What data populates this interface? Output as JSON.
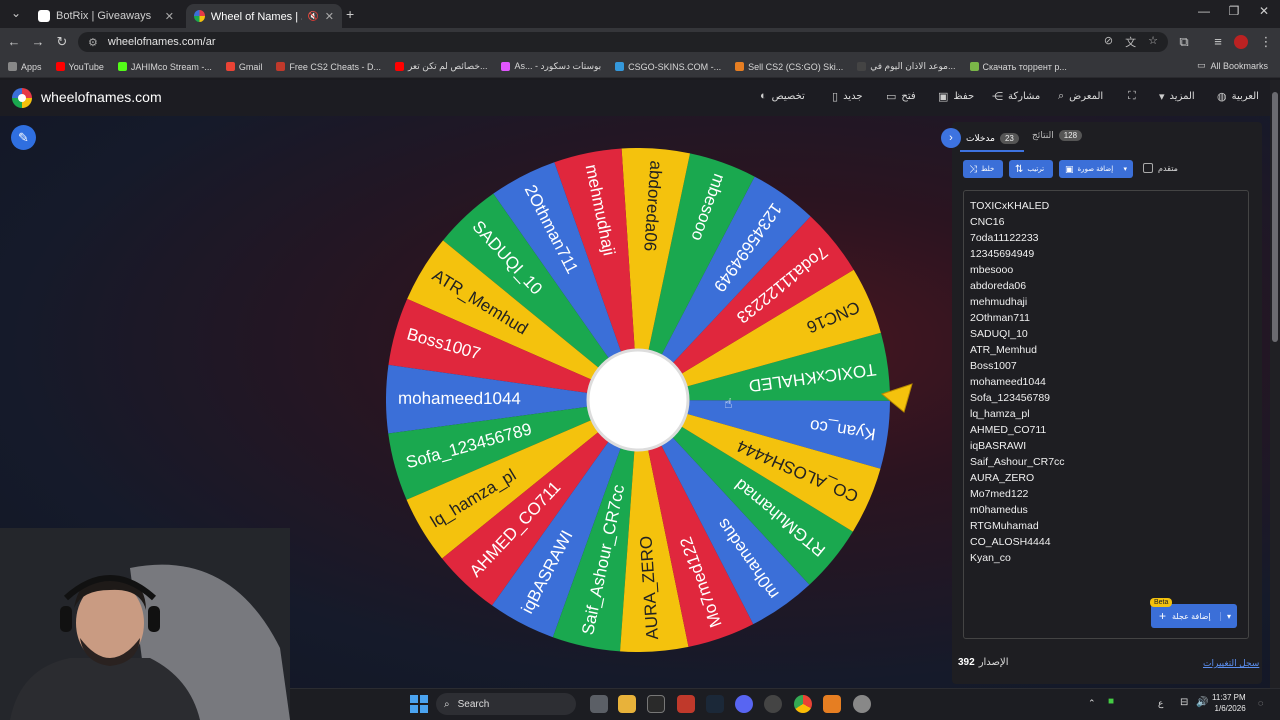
{
  "browser": {
    "tabs": [
      {
        "title": "BotRix | Giveaways",
        "favicon_color": "#ffffff"
      },
      {
        "title": "Wheel of Names | العشوائي",
        "favicon_color": "#e63946"
      }
    ],
    "url": "wheelofnames.com/ar",
    "bookmarks": [
      {
        "label": "Apps",
        "color": "#888888"
      },
      {
        "label": "YouTube",
        "color": "#ff0000"
      },
      {
        "label": "JAHIMco Stream -...",
        "color": "#53fc18"
      },
      {
        "label": "Gmail",
        "color": "#ea4335"
      },
      {
        "label": "Free CS2 Cheats - D...",
        "color": "#c0392b"
      },
      {
        "label": "خصائص لم تكن تعر...",
        "color": "#ff0000"
      },
      {
        "label": "As... - بوستات دسكورد",
        "color": "#e056fd"
      },
      {
        "label": "CSGO-SKINS.COM -...",
        "color": "#3498db"
      },
      {
        "label": "Sell CS2 (CS:GO) Ski...",
        "color": "#e67e22"
      },
      {
        "label": "موعد الاذان اليوم في...",
        "color": "#444444"
      },
      {
        "label": "Скачать торрент р...",
        "color": "#7ab648"
      }
    ],
    "all_bookmarks": "All Bookmarks"
  },
  "site": {
    "brand": "wheelofnames.com",
    "menu": [
      {
        "label": "تخصيص",
        "icon": "palette-icon"
      },
      {
        "label": "جديد",
        "icon": "new-file-icon"
      },
      {
        "label": "فتح",
        "icon": "folder-icon"
      },
      {
        "label": "حفظ",
        "icon": "save-icon"
      },
      {
        "label": "مشاركة",
        "icon": "share-icon"
      },
      {
        "label": "المعرض",
        "icon": "search-icon"
      },
      {
        "label": "",
        "icon": "fullscreen-icon"
      },
      {
        "label": "المزيد",
        "icon": "chevron-down-icon"
      },
      {
        "label": "العربية",
        "icon": "globe-icon"
      }
    ]
  },
  "panel": {
    "entries_tab": "مدخلات",
    "entries_count": "23",
    "results_tab": "النتائج",
    "results_count": "128",
    "shuffle_label": "خلط",
    "sort_label": "ترتيب",
    "add_image_label": "إضافة صورة",
    "advanced_label": "متقدم",
    "quick_add_label": "إضافة عجلة",
    "beta_label": "Beta",
    "version_label": "الإصدار",
    "version_number": "392",
    "changelog_label": "سجل التغييرات"
  },
  "entries": [
    "TOXICxKHALED",
    "CNC16",
    "7oda11122233",
    "12345694949",
    "mbesooo",
    "abdoreda06",
    "mehmudhaji",
    "2Othman711",
    "SADUQI_10",
    "ATR_Memhud",
    "Boss1007",
    "mohameed1044",
    "Sofa_123456789",
    "lq_hamza_pl",
    "AHMED_CO711",
    "iqBASRAWI",
    "Saif_Ashour_CR7cc",
    "AURA_ZERO",
    "Mo7med122",
    "m0hamedus",
    "RTGMuhamad",
    "CO_ALOSH4444",
    "Kyan_co"
  ],
  "wheel": {
    "colors": [
      "#3b6fd8",
      "#1aa84f",
      "#f4c20d",
      "#e0273d"
    ],
    "pointer_color": "#f4c20d",
    "rotation_deg": 8
  },
  "taskbar": {
    "search_placeholder": "Search",
    "time": "11:37 PM",
    "date": "1/6/2026",
    "lang": "ع"
  }
}
